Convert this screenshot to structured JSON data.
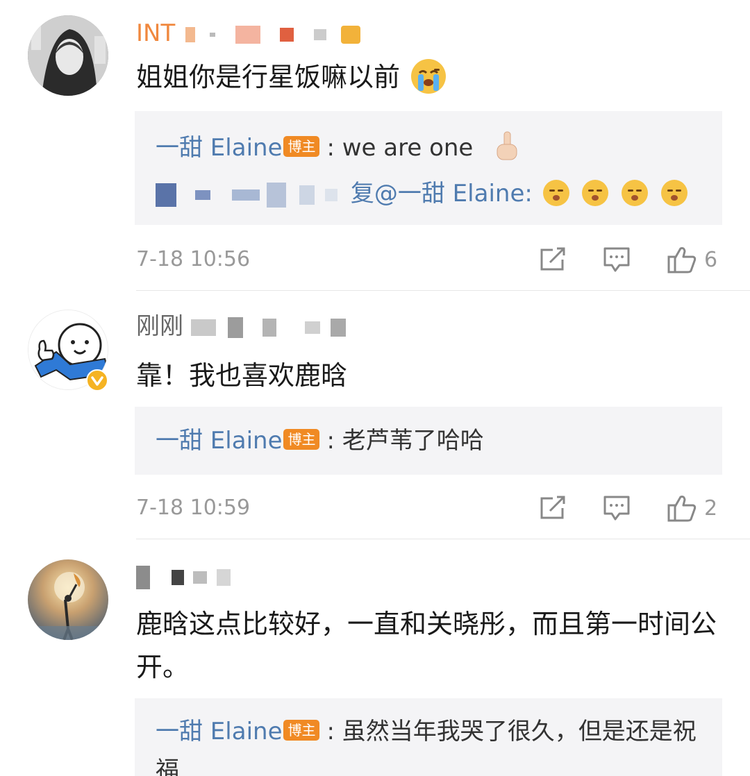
{
  "comments": [
    {
      "username": "INT",
      "text": "姐姐你是行星饭嘛以前",
      "replies": [
        {
          "author": "一甜 Elaine",
          "badge": "博主",
          "text": ": we are one"
        },
        {
          "prefix": "复",
          "author": "@一甜 Elaine:",
          "text": ""
        }
      ],
      "time": "7-18 10:56",
      "likes": "6"
    },
    {
      "username": "刚刚",
      "text": "靠！我也喜欢鹿晗",
      "replies": [
        {
          "author": "一甜 Elaine",
          "badge": "博主",
          "text": ": 老芦苇了哈哈"
        }
      ],
      "time": "7-18 10:59",
      "likes": "2"
    },
    {
      "username": "",
      "text": "鹿晗这点比较好，一直和关晓彤，而且第一时间公开。",
      "replies": [
        {
          "author": "一甜 Elaine",
          "badge": "博主",
          "text": ": 虽然当年我哭了很久，但是还是祝福"
        }
      ]
    }
  ],
  "icons": {
    "share": "share-icon",
    "comment": "comment-icon",
    "like": "thumbs-up-icon",
    "verified": "verified-badge-icon"
  },
  "colors": {
    "link_blue": "#4f7baf",
    "badge_orange": "#f08a24",
    "verified_yellow": "#f5b323",
    "reply_bg": "#f4f4f6",
    "meta_gray": "#999999"
  }
}
